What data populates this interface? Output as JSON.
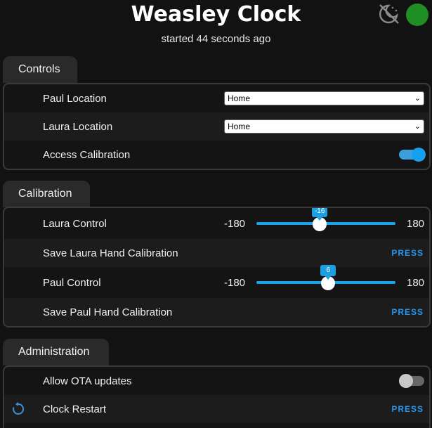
{
  "header": {
    "title": "Weasley Clock",
    "subtitle": "started 44 seconds ago",
    "status_color": "#1f8e23"
  },
  "controls": {
    "tab_label": "Controls",
    "paul_location": {
      "label": "Paul Location",
      "value": "Home"
    },
    "laura_location": {
      "label": "Laura Location",
      "value": "Home"
    },
    "access_calibration": {
      "label": "Access Calibration",
      "state": "on"
    }
  },
  "calibration": {
    "tab_label": "Calibration",
    "laura_control": {
      "label": "Laura Control",
      "min": "-180",
      "max": "180",
      "value": -16,
      "value_label": "-16"
    },
    "save_laura": {
      "label": "Save Laura Hand Calibration",
      "action": "PRESS"
    },
    "paul_control": {
      "label": "Paul Control",
      "min": "-180",
      "max": "180",
      "value": 6,
      "value_label": "6"
    },
    "save_paul": {
      "label": "Save Paul Hand Calibration",
      "action": "PRESS"
    }
  },
  "administration": {
    "tab_label": "Administration",
    "allow_ota": {
      "label": "Allow OTA updates",
      "state": "off"
    },
    "clock_restart": {
      "label": "Clock Restart",
      "action": "PRESS"
    }
  },
  "colors": {
    "accent": "#1aa3e8",
    "background": "#121212",
    "press_text": "#2196f3"
  }
}
